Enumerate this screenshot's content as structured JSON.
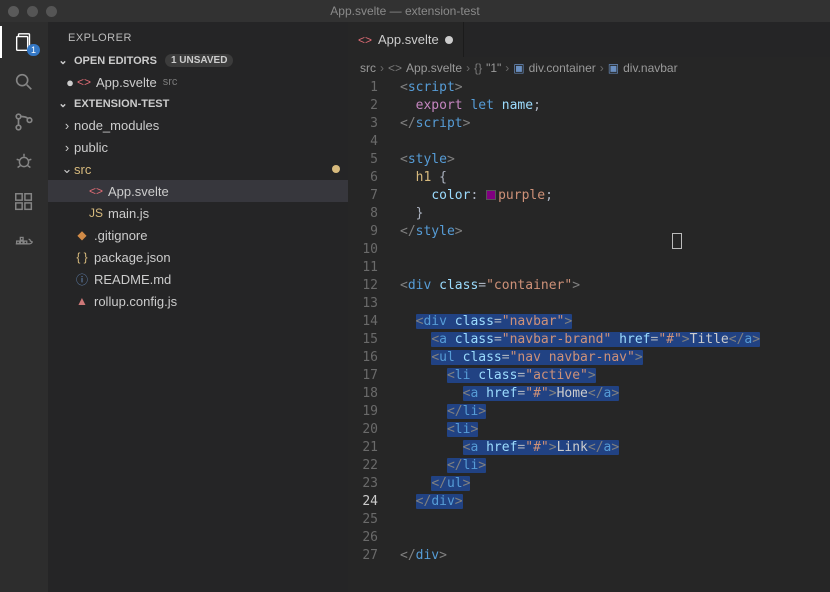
{
  "window": {
    "title": "App.svelte — extension-test"
  },
  "activity": {
    "explorer": "Explorer",
    "badge_count": "1"
  },
  "sidebar": {
    "title": "EXPLORER",
    "open_editors": {
      "label": "OPEN EDITORS",
      "unsaved": "1 UNSAVED",
      "items": [
        {
          "name": "App.svelte",
          "meta": "src",
          "icon": "svelte",
          "modified": true
        }
      ]
    },
    "workspace": {
      "label": "EXTENSION-TEST",
      "tree": [
        {
          "twisty": ">",
          "indent": 0,
          "name": "node_modules",
          "type": "folder"
        },
        {
          "twisty": ">",
          "indent": 0,
          "name": "public",
          "type": "folder"
        },
        {
          "twisty": "v",
          "indent": 0,
          "name": "src",
          "type": "folder",
          "modified": true,
          "tint": "#d7ba7d"
        },
        {
          "twisty": "",
          "indent": 1,
          "name": "App.svelte",
          "type": "svelte",
          "active": true
        },
        {
          "twisty": "",
          "indent": 1,
          "name": "main.js",
          "type": "js"
        },
        {
          "twisty": "",
          "indent": 0,
          "name": ".gitignore",
          "type": "git"
        },
        {
          "twisty": "",
          "indent": 0,
          "name": "package.json",
          "type": "json"
        },
        {
          "twisty": "",
          "indent": 0,
          "name": "README.md",
          "type": "md"
        },
        {
          "twisty": "",
          "indent": 0,
          "name": "rollup.config.js",
          "type": "rollup"
        }
      ]
    }
  },
  "tabs": [
    {
      "name": "App.svelte",
      "icon": "svelte",
      "dirty": true
    }
  ],
  "breadcrumb": {
    "parts": [
      "src",
      "App.svelte",
      "\"1\"",
      "div.container",
      "div.navbar"
    ]
  },
  "editor": {
    "line_count": 27,
    "current_line": 24,
    "code_lines": [
      {
        "html": "<span class='t-brk'>&lt;</span><span class='t-tag'>script</span><span class='t-brk'>&gt;</span>"
      },
      {
        "html": "  <span class='t-kw'>export</span> <span class='t-kw2'>let</span> <span class='t-id'>name</span><span class='t-punc'>;</span>"
      },
      {
        "html": "<span class='t-brk'>&lt;/</span><span class='t-tag'>script</span><span class='t-brk'>&gt;</span>"
      },
      {
        "html": ""
      },
      {
        "html": "<span class='t-brk'>&lt;</span><span class='t-tag'>style</span><span class='t-brk'>&gt;</span>"
      },
      {
        "html": "  <span class='t-sel2'>h1</span> <span class='t-punc'>{</span>"
      },
      {
        "html": "    <span class='t-prop'>color</span><span class='t-punc'>:</span> <span class='swatch'></span><span class='t-val'>purple</span><span class='t-punc'>;</span>"
      },
      {
        "html": "  <span class='t-punc'>}</span>"
      },
      {
        "html": "<span class='t-brk'>&lt;/</span><span class='t-tag'>style</span><span class='t-brk'>&gt;</span>"
      },
      {
        "html": ""
      },
      {
        "html": ""
      },
      {
        "html": "<span class='t-brk'>&lt;</span><span class='t-tag'>div</span> <span class='t-attr'>class</span><span class='t-punc'>=</span><span class='t-str'>\"container\"</span><span class='t-brk'>&gt;</span>"
      },
      {
        "html": ""
      },
      {
        "html": "  <span class='sel'><span class='t-brk'>&lt;</span><span class='t-tag'>div</span> <span class='t-attr'>class</span><span class='t-punc'>=</span><span class='t-str'>\"navbar\"</span><span class='t-brk'>&gt;</span></span>"
      },
      {
        "html": "    <span class='sel'><span class='t-brk'>&lt;</span><span class='t-tag'>a</span> <span class='t-attr'>class</span><span class='t-punc'>=</span><span class='t-str'>\"navbar-brand\"</span> <span class='t-attr'>href</span><span class='t-punc'>=</span><span class='t-str'>\"#\"</span><span class='t-brk'>&gt;</span>Title<span class='t-brk'>&lt;/</span><span class='t-tag'>a</span><span class='t-brk'>&gt;</span></span>"
      },
      {
        "html": "    <span class='sel'><span class='t-brk'>&lt;</span><span class='t-tag'>ul</span> <span class='t-attr'>class</span><span class='t-punc'>=</span><span class='t-str'>\"nav navbar-nav\"</span><span class='t-brk'>&gt;</span></span>"
      },
      {
        "html": "      <span class='sel'><span class='t-brk'>&lt;</span><span class='t-tag'>li</span> <span class='t-attr'>class</span><span class='t-punc'>=</span><span class='t-str'>\"active\"</span><span class='t-brk'>&gt;</span></span>"
      },
      {
        "html": "        <span class='sel'><span class='t-brk'>&lt;</span><span class='t-tag'>a</span> <span class='t-attr'>href</span><span class='t-punc'>=</span><span class='t-str'>\"#\"</span><span class='t-brk'>&gt;</span>Home<span class='t-brk'>&lt;/</span><span class='t-tag'>a</span><span class='t-brk'>&gt;</span></span>"
      },
      {
        "html": "      <span class='sel'><span class='t-brk'>&lt;/</span><span class='t-tag'>li</span><span class='t-brk'>&gt;</span></span>"
      },
      {
        "html": "      <span class='sel'><span class='t-brk'>&lt;</span><span class='t-tag'>li</span><span class='t-brk'>&gt;</span></span>"
      },
      {
        "html": "        <span class='sel'><span class='t-brk'>&lt;</span><span class='t-tag'>a</span> <span class='t-attr'>href</span><span class='t-punc'>=</span><span class='t-str'>\"#\"</span><span class='t-brk'>&gt;</span>Link<span class='t-brk'>&lt;/</span><span class='t-tag'>a</span><span class='t-brk'>&gt;</span></span>"
      },
      {
        "html": "      <span class='sel'><span class='t-brk'>&lt;/</span><span class='t-tag'>li</span><span class='t-brk'>&gt;</span></span>"
      },
      {
        "html": "    <span class='sel'><span class='t-brk'>&lt;/</span><span class='t-tag'>ul</span><span class='t-brk'>&gt;</span></span>"
      },
      {
        "html": "  <span class='sel'><span class='t-brk'>&lt;/</span><span class='t-tag'>div</span><span class='t-brk'>&gt;</span></span>"
      },
      {
        "html": ""
      },
      {
        "html": ""
      },
      {
        "html": "<span class='t-brk'>&lt;/</span><span class='t-tag'>div</span><span class='t-brk'>&gt;</span>"
      }
    ]
  },
  "icons": {
    "svelte": "<>",
    "js": "JS",
    "json": "{ }",
    "md": "ⓘ",
    "git": "◆",
    "rollup": "▲",
    "folder_closed": "›",
    "folder_open": "⌄"
  },
  "colors": {
    "bg": "#262626",
    "sidebar_bg": "#252526",
    "selection": "#214283",
    "accent": "#3478c6",
    "modified": "#d7ba7d"
  }
}
